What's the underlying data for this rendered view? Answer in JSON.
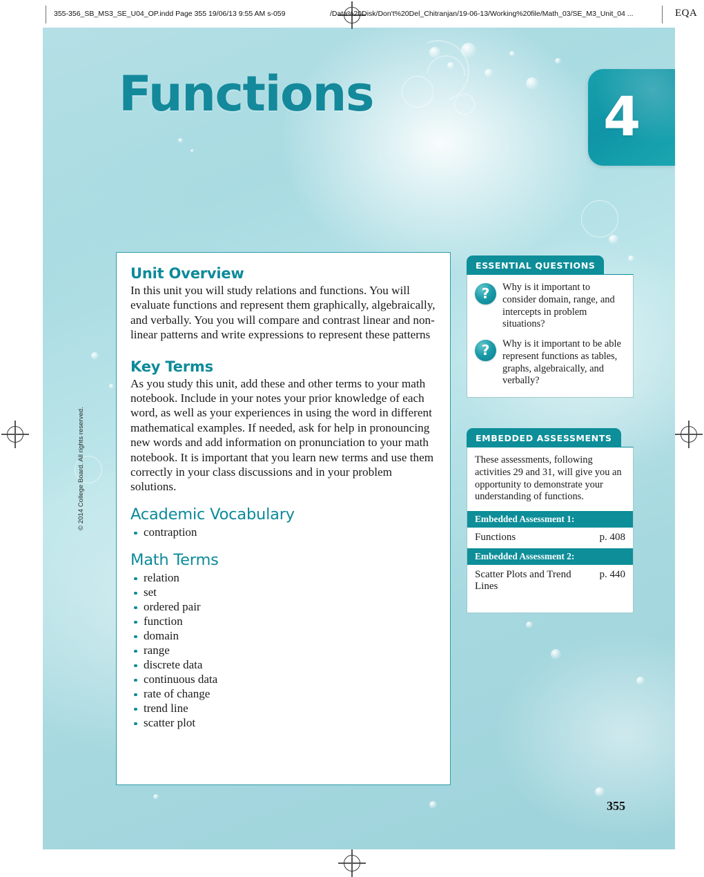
{
  "slug": {
    "filename": "355-356_SB_MS3_SE_U04_OP.indd Page 355  19/06/13  9:55 AM s-059",
    "path": "/Data%20Disk/Don't%20Del_Chitranjan/19-06-13/Working%20file/Math_03/SE_M3_Unit_04 ...",
    "eqa": "EQA"
  },
  "unit": {
    "title": "Functions",
    "number": "4",
    "accent_color": "#0d8e99",
    "background_color": "#a9dbe2"
  },
  "panel": {
    "unit_overview": {
      "heading": "Unit Overview",
      "body": "In this unit you will study relations and functions. You will evaluate functions and represent them graphically, algebraically, and verbally. You you will compare and contrast linear and non-linear patterns and write expressions to represent these patterns"
    },
    "key_terms": {
      "heading": "Key Terms",
      "body": "As you study this unit, add these and other terms to your math notebook. Include in your notes your prior knowledge of each word, as well as your experiences in using the word in different mathematical examples. If needed, ask for help in pronouncing new words and add information on pronunciation to your math notebook. It is important that you learn new terms and use them correctly in your class discussions and in your problem solutions."
    },
    "academic_vocabulary": {
      "heading": "Academic Vocabulary",
      "items": [
        "contraption"
      ]
    },
    "math_terms": {
      "heading": "Math Terms",
      "items": [
        "relation",
        "set",
        "ordered pair",
        "function",
        "domain",
        "range",
        "discrete data",
        "continuous data",
        "rate of change",
        "trend line",
        "scatter plot"
      ]
    }
  },
  "essential_questions": {
    "tab_label": "ESSENTIAL QUESTIONS",
    "questions": [
      "Why is it important to consider domain, range, and intercepts in problem situations?",
      "Why is it important to be able represent functions as tables, graphs, algebraically, and verbally?"
    ],
    "icon": "question-mark-icon"
  },
  "embedded_assessments": {
    "tab_label": "EMBEDDED ASSESSMENTS",
    "intro": "These assessments, following activities 29 and 31, will give you an opportunity to demonstrate your understanding of functions.",
    "items": [
      {
        "head": "Embedded Assessment 1:",
        "title": "Functions",
        "page": "p. 408"
      },
      {
        "head": "Embedded Assessment 2:",
        "title": "Scatter Plots and Trend Lines",
        "page": "p. 440"
      }
    ]
  },
  "footer": {
    "copyright": "© 2014 College Board. All rights reserved.",
    "page_number": "355"
  }
}
